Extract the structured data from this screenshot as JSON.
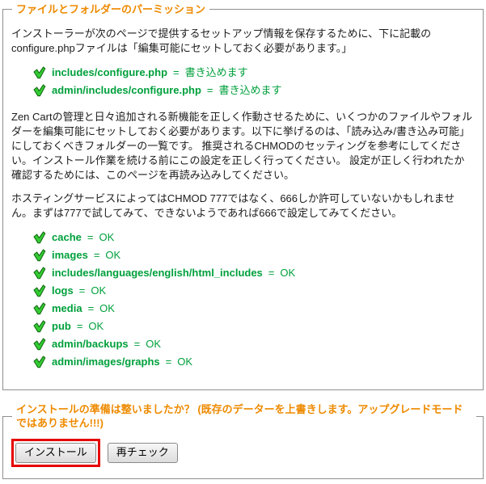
{
  "permissions_section": {
    "legend": "ファイルとフォルダーのパーミッション",
    "intro": "インストーラーが次のページで提供するセットアップ情報を保存するために、下に記載のconfigure.phpファイルは「編集可能にセットしておく必要があります。」",
    "separator": "=",
    "config_files": [
      {
        "name": "includes/configure.php",
        "status": "書き込めます"
      },
      {
        "name": "admin/includes/configure.php",
        "status": "書き込めます"
      }
    ],
    "chmod_paragraph": "Zen Cartの管理と日々追加される新機能を正しく作動させるために、いくつかのファイルやフォルダーを編集可能にセットしておく必要があります。以下に挙げるのは、「読み込み/書き込み可能」にしておくべきフォルダーの一覧です。 推奨されるCHMODのセッティングを参考にしてください。インストール作業を続ける前にこの設定を正しく行ってください。 設定が正しく行われたか確認するためには、このページを再読み込みしてください。",
    "hosting_paragraph": "ホスティングサービスによってはCHMOD 777ではなく、666しか許可していないかもしれません。まずは777で試してみて、できないようであれば666で設定してみてください。",
    "folders": [
      {
        "name": "cache",
        "status": "OK"
      },
      {
        "name": "images",
        "status": "OK"
      },
      {
        "name": "includes/languages/english/html_includes",
        "status": "OK"
      },
      {
        "name": "logs",
        "status": "OK"
      },
      {
        "name": "media",
        "status": "OK"
      },
      {
        "name": "pub",
        "status": "OK"
      },
      {
        "name": "admin/backups",
        "status": "OK"
      },
      {
        "name": "admin/images/graphs",
        "status": "OK"
      }
    ]
  },
  "install_section": {
    "legend": "インストールの準備は整いましたか？ (既存のデーターを上書きします。アップグレードモードではありません!!!)",
    "install_button": "インストール",
    "recheck_button": "再チェック"
  },
  "colors": {
    "legend_orange": "#ee8a00",
    "status_green": "#00a03c",
    "annotation_red": "#e60000",
    "check_icon_green": "#33cc33"
  }
}
